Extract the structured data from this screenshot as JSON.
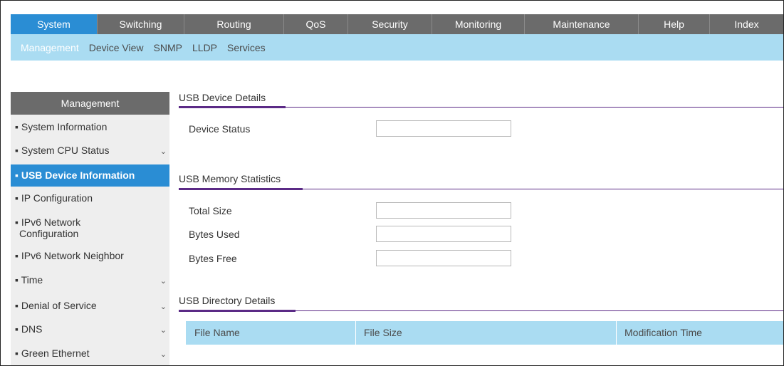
{
  "top_nav": [
    {
      "label": "System"
    },
    {
      "label": "Switching"
    },
    {
      "label": "Routing"
    },
    {
      "label": "QoS"
    },
    {
      "label": "Security"
    },
    {
      "label": "Monitoring"
    },
    {
      "label": "Maintenance"
    },
    {
      "label": "Help"
    },
    {
      "label": "Index"
    }
  ],
  "sub_nav": [
    {
      "label": "Management"
    },
    {
      "label": "Device View"
    },
    {
      "label": "SNMP"
    },
    {
      "label": "LLDP"
    },
    {
      "label": "Services"
    }
  ],
  "sidebar": {
    "title": "Management",
    "items": [
      {
        "label": "▪ System Information"
      },
      {
        "label": "▪ System CPU Status"
      },
      {
        "label": "▪ USB Device Information"
      },
      {
        "label": "▪ IP Configuration"
      },
      {
        "label": "▪ IPv6 Network",
        "label2": "Configuration"
      },
      {
        "label": "▪ IPv6 Network Neighbor"
      },
      {
        "label": "▪ Time"
      },
      {
        "label": "▪ Denial of Service"
      },
      {
        "label": "▪ DNS"
      },
      {
        "label": "▪ Green Ethernet"
      }
    ]
  },
  "usb_device_details": {
    "title": "USB Device Details",
    "device_status_label": "Device Status",
    "device_status_value": ""
  },
  "usb_memory_statistics": {
    "title": "USB Memory Statistics",
    "total_size_label": "Total Size",
    "total_size_value": "",
    "bytes_used_label": "Bytes Used",
    "bytes_used_value": "",
    "bytes_free_label": "Bytes Free",
    "bytes_free_value": ""
  },
  "usb_directory_details": {
    "title": "USB Directory Details",
    "columns": [
      "File Name",
      "File Size",
      "Modification Time"
    ]
  },
  "colors": {
    "accent_blue": "#2a8dd4",
    "subnav_bg": "#aadcf2",
    "nav_gray": "#6b6b6b",
    "section_line": "#5b2a86"
  },
  "icons": {
    "expand": "chevron-down-icon"
  }
}
